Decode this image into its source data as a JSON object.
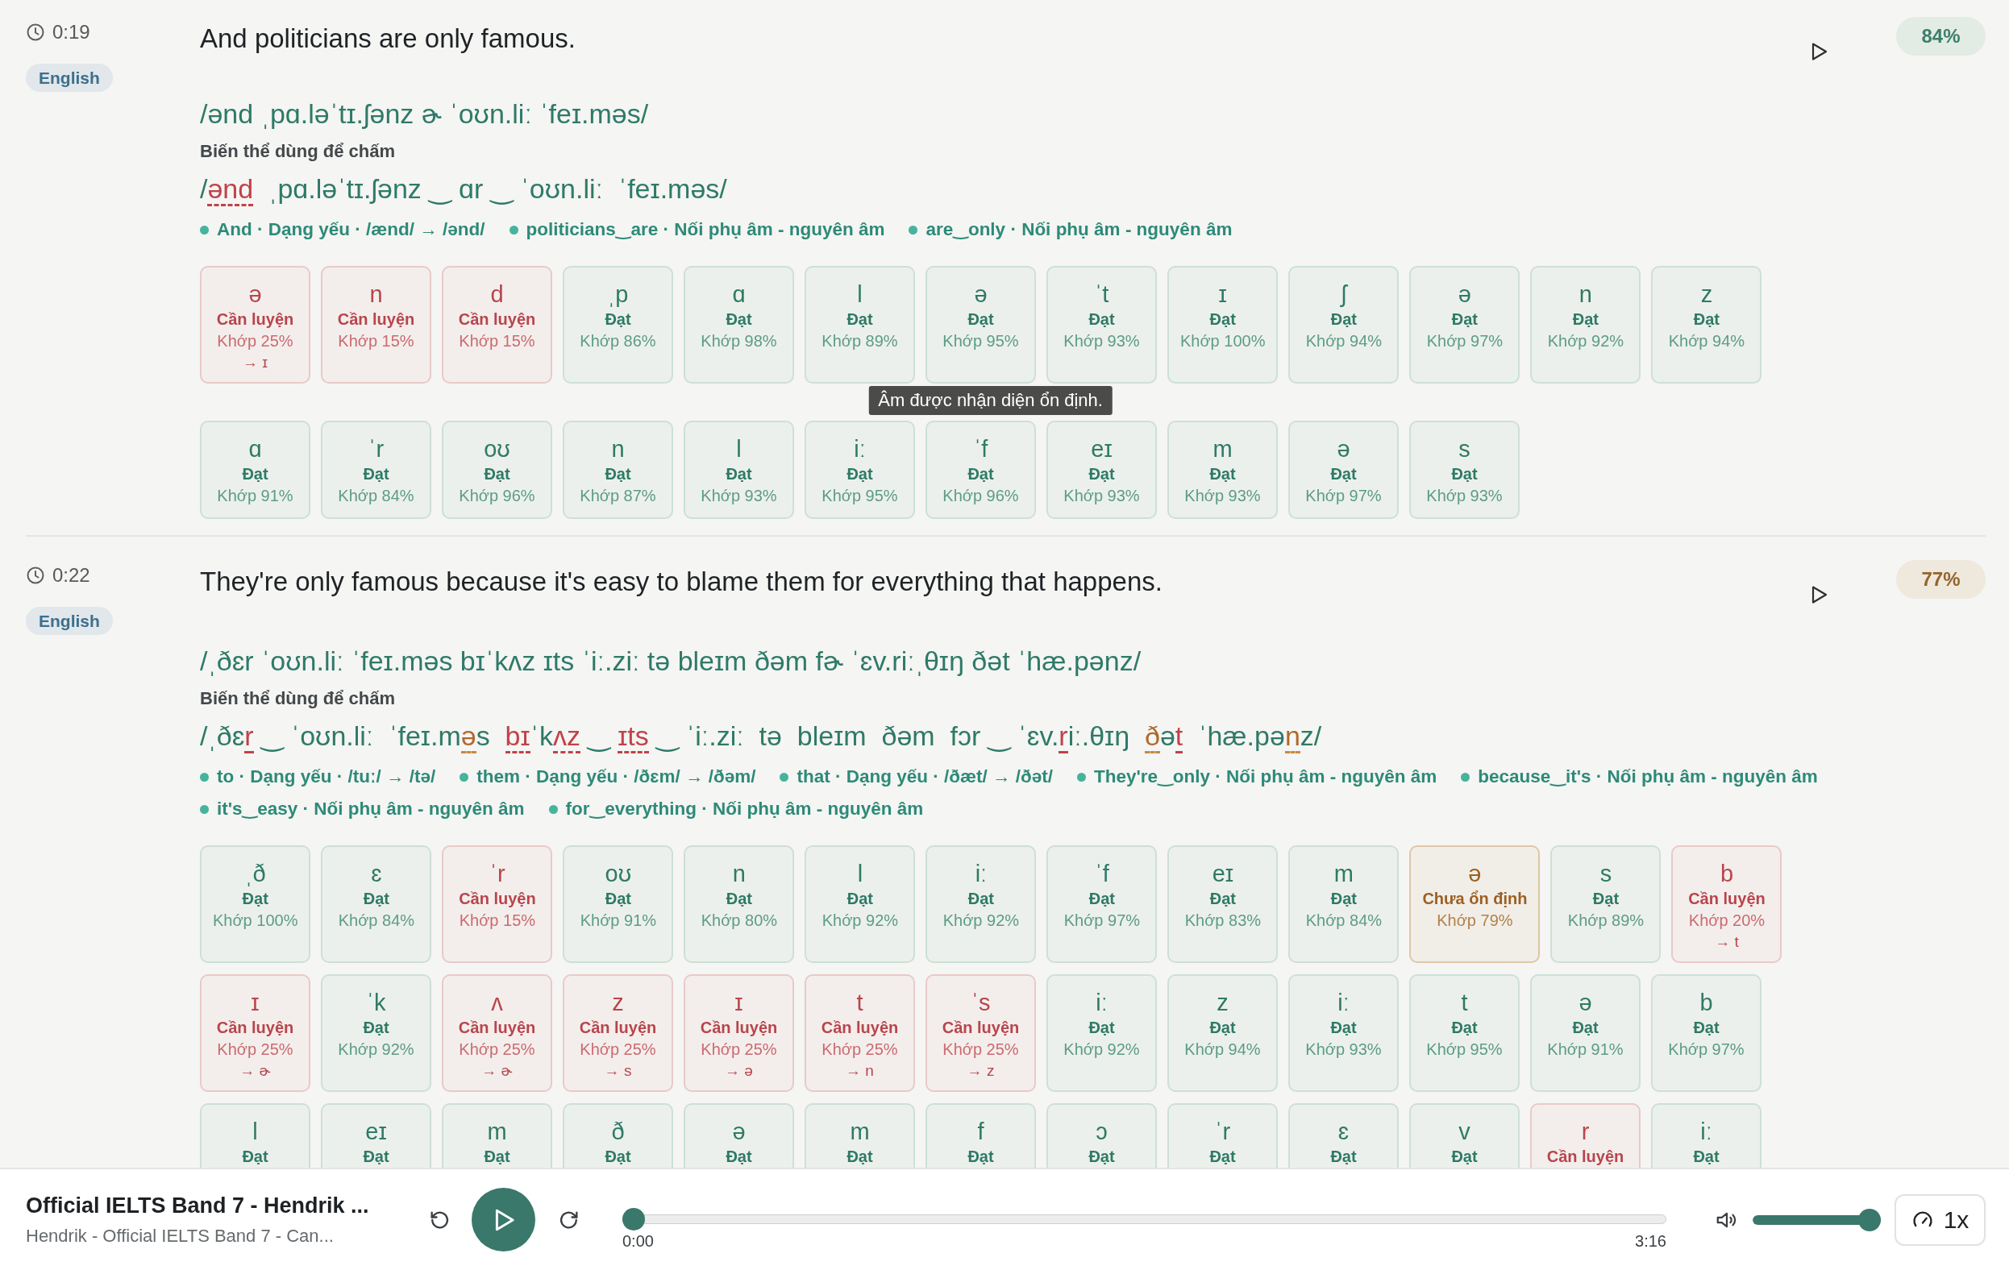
{
  "segments": [
    {
      "time": "0:19",
      "language": "English",
      "sentence": "And politicians are only famous.",
      "score": {
        "text": "84%",
        "kind": "good"
      },
      "ipa": "/ənd ˌpɑ.ləˈtɪ.ʃənz ɚ ˈoʊn.liː ˈfeɪ.məs/",
      "variant_label": "Biến thể dùng để chấm",
      "variant": [
        {
          "text": "/",
          "kind": "plain"
        },
        {
          "text": "ənd",
          "kind": "error"
        },
        {
          "text": "  ˌpɑ.ləˈtɪ.ʃənz ‿ ɑr ‿ ˈoʊn.liː  ˈfeɪ.məs/",
          "kind": "plain"
        }
      ],
      "notes": [
        "And · Dạng yếu · /ænd/ → /ənd/",
        "politicians‿are · Nối phụ âm - nguyên âm",
        "are‿only · Nối phụ âm - nguyên âm"
      ],
      "phonemes": [
        {
          "symbol": "ə",
          "status": "Cần luyện",
          "kind": "practice",
          "match": "Khớp 25%",
          "heard": "→ ɪ"
        },
        {
          "symbol": "n",
          "status": "Cần luyện",
          "kind": "practice",
          "match": "Khớp 15%"
        },
        {
          "symbol": "d",
          "status": "Cần luyện",
          "kind": "practice",
          "match": "Khớp 15%"
        },
        {
          "symbol": "ˌp",
          "status": "Đạt",
          "kind": "pass",
          "match": "Khớp 86%"
        },
        {
          "symbol": "ɑ",
          "status": "Đạt",
          "kind": "pass",
          "match": "Khớp 98%"
        },
        {
          "symbol": "l",
          "status": "Đạt",
          "kind": "pass",
          "match": "Khớp 89%"
        },
        {
          "symbol": "ə",
          "status": "Đạt",
          "kind": "pass",
          "match": "Khớp 95%",
          "tooltip": "Âm được nhận diện ổn định."
        },
        {
          "symbol": "ˈt",
          "status": "Đạt",
          "kind": "pass",
          "match": "Khớp 93%"
        },
        {
          "symbol": "ɪ",
          "status": "Đạt",
          "kind": "pass",
          "match": "Khớp 100%"
        },
        {
          "symbol": "ʃ",
          "status": "Đạt",
          "kind": "pass",
          "match": "Khớp 94%"
        },
        {
          "symbol": "ə",
          "status": "Đạt",
          "kind": "pass",
          "match": "Khớp 97%"
        },
        {
          "symbol": "n",
          "status": "Đạt",
          "kind": "pass",
          "match": "Khớp 92%"
        },
        {
          "symbol": "z",
          "status": "Đạt",
          "kind": "pass",
          "match": "Khớp 94%"
        },
        {
          "symbol": "ɑ",
          "status": "Đạt",
          "kind": "pass",
          "match": "Khớp 91%"
        },
        {
          "symbol": "ˈr",
          "status": "Đạt",
          "kind": "pass",
          "match": "Khớp 84%"
        },
        {
          "symbol": "oʊ",
          "status": "Đạt",
          "kind": "pass",
          "match": "Khớp 96%"
        },
        {
          "symbol": "n",
          "status": "Đạt",
          "kind": "pass",
          "match": "Khớp 87%"
        },
        {
          "symbol": "l",
          "status": "Đạt",
          "kind": "pass",
          "match": "Khớp 93%"
        },
        {
          "symbol": "iː",
          "status": "Đạt",
          "kind": "pass",
          "match": "Khớp 95%"
        },
        {
          "symbol": "ˈf",
          "status": "Đạt",
          "kind": "pass",
          "match": "Khớp 96%"
        },
        {
          "symbol": "eɪ",
          "status": "Đạt",
          "kind": "pass",
          "match": "Khớp 93%"
        },
        {
          "symbol": "m",
          "status": "Đạt",
          "kind": "pass",
          "match": "Khớp 93%"
        },
        {
          "symbol": "ə",
          "status": "Đạt",
          "kind": "pass",
          "match": "Khớp 97%"
        },
        {
          "symbol": "s",
          "status": "Đạt",
          "kind": "pass",
          "match": "Khớp 93%"
        }
      ]
    },
    {
      "time": "0:22",
      "language": "English",
      "sentence": "They're only famous because it's easy to blame them for everything that happens.",
      "score": {
        "text": "77%",
        "kind": "fair"
      },
      "ipa": "/ˌðɛr ˈoʊn.liː ˈfeɪ.məs bɪˈkʌz ɪts ˈiː.ziː tə bleɪm ðəm fɚ ˈɛv.riːˌθɪŋ ðət ˈhæ.pənz/",
      "variant_label": "Biến thể dùng để chấm",
      "variant": [
        {
          "text": "/ˌðɛ",
          "kind": "plain"
        },
        {
          "text": "r",
          "kind": "error"
        },
        {
          "text": " ‿ ˈoʊn.liː  ˈfeɪ.m",
          "kind": "plain"
        },
        {
          "text": "ə",
          "kind": "warn"
        },
        {
          "text": "s  ",
          "kind": "plain"
        },
        {
          "text": "bɪ",
          "kind": "error"
        },
        {
          "text": "ˈk",
          "kind": "plain"
        },
        {
          "text": "ʌz",
          "kind": "error"
        },
        {
          "text": " ‿ ",
          "kind": "plain"
        },
        {
          "text": "ɪts",
          "kind": "error"
        },
        {
          "text": " ‿ ˈiː.ziː  tə  bleɪm  ðəm  fɔr ‿ ˈɛv.",
          "kind": "plain"
        },
        {
          "text": "r",
          "kind": "error"
        },
        {
          "text": "iː.θɪŋ  ",
          "kind": "plain"
        },
        {
          "text": "ð",
          "kind": "warn"
        },
        {
          "text": "ə",
          "kind": "plain"
        },
        {
          "text": "t",
          "kind": "error"
        },
        {
          "text": "  ˈhæ.pə",
          "kind": "plain"
        },
        {
          "text": "n",
          "kind": "warn"
        },
        {
          "text": "z/",
          "kind": "plain"
        }
      ],
      "notes": [
        "to · Dạng yếu · /tuː/ → /tə/",
        "them · Dạng yếu · /ðɛm/ → /ðəm/",
        "that · Dạng yếu · /ðæt/ → /ðət/",
        "They're‿only · Nối phụ âm - nguyên âm",
        "because‿it's · Nối phụ âm - nguyên âm",
        "it's‿easy · Nối phụ âm - nguyên âm",
        "for‿everything · Nối phụ âm - nguyên âm"
      ],
      "phonemes": [
        {
          "symbol": "ˌð",
          "status": "Đạt",
          "kind": "pass",
          "match": "Khớp 100%"
        },
        {
          "symbol": "ɛ",
          "status": "Đạt",
          "kind": "pass",
          "match": "Khớp 84%"
        },
        {
          "symbol": "ˈr",
          "status": "Cần luyện",
          "kind": "practice",
          "match": "Khớp 15%"
        },
        {
          "symbol": "oʊ",
          "status": "Đạt",
          "kind": "pass",
          "match": "Khớp 91%"
        },
        {
          "symbol": "n",
          "status": "Đạt",
          "kind": "pass",
          "match": "Khớp 80%"
        },
        {
          "symbol": "l",
          "status": "Đạt",
          "kind": "pass",
          "match": "Khớp 92%"
        },
        {
          "symbol": "iː",
          "status": "Đạt",
          "kind": "pass",
          "match": "Khớp 92%"
        },
        {
          "symbol": "ˈf",
          "status": "Đạt",
          "kind": "pass",
          "match": "Khớp 97%"
        },
        {
          "symbol": "eɪ",
          "status": "Đạt",
          "kind": "pass",
          "match": "Khớp 83%"
        },
        {
          "symbol": "m",
          "status": "Đạt",
          "kind": "pass",
          "match": "Khớp 84%"
        },
        {
          "symbol": "ə",
          "status": "Chưa ổn định",
          "kind": "unstable",
          "match": "Khớp 79%"
        },
        {
          "symbol": "s",
          "status": "Đạt",
          "kind": "pass",
          "match": "Khớp 89%"
        },
        {
          "symbol": "b",
          "status": "Cần luyện",
          "kind": "practice",
          "match": "Khớp 20%",
          "heard": "→ t"
        },
        {
          "symbol": "ɪ",
          "status": "Cần luyện",
          "kind": "practice",
          "match": "Khớp 25%",
          "heard": "→ ɚ"
        },
        {
          "symbol": "ˈk",
          "status": "Đạt",
          "kind": "pass",
          "match": "Khớp 92%"
        },
        {
          "symbol": "ʌ",
          "status": "Cần luyện",
          "kind": "practice",
          "match": "Khớp 25%",
          "heard": "→ ɚ"
        },
        {
          "symbol": "z",
          "status": "Cần luyện",
          "kind": "practice",
          "match": "Khớp 25%",
          "heard": "→ s"
        },
        {
          "symbol": "ɪ",
          "status": "Cần luyện",
          "kind": "practice",
          "match": "Khớp 25%",
          "heard": "→ ə"
        },
        {
          "symbol": "t",
          "status": "Cần luyện",
          "kind": "practice",
          "match": "Khớp 25%",
          "heard": "→ n"
        },
        {
          "symbol": "ˈs",
          "status": "Cần luyện",
          "kind": "practice",
          "match": "Khớp 25%",
          "heard": "→ z"
        },
        {
          "symbol": "iː",
          "status": "Đạt",
          "kind": "pass",
          "match": "Khớp 92%"
        },
        {
          "symbol": "z",
          "status": "Đạt",
          "kind": "pass",
          "match": "Khớp 94%"
        },
        {
          "symbol": "iː",
          "status": "Đạt",
          "kind": "pass",
          "match": "Khớp 93%"
        },
        {
          "symbol": "t",
          "status": "Đạt",
          "kind": "pass",
          "match": "Khớp 95%"
        },
        {
          "symbol": "ə",
          "status": "Đạt",
          "kind": "pass",
          "match": "Khớp 91%"
        },
        {
          "symbol": "b",
          "status": "Đạt",
          "kind": "pass",
          "match": "Khớp 97%"
        },
        {
          "symbol": "l",
          "status": "Đạt",
          "kind": "pass"
        },
        {
          "symbol": "eɪ",
          "status": "Đạt",
          "kind": "pass"
        },
        {
          "symbol": "m",
          "status": "Đạt",
          "kind": "pass"
        },
        {
          "symbol": "ð",
          "status": "Đạt",
          "kind": "pass"
        },
        {
          "symbol": "ə",
          "status": "Đạt",
          "kind": "pass"
        },
        {
          "symbol": "m",
          "status": "Đạt",
          "kind": "pass"
        },
        {
          "symbol": "f",
          "status": "Đạt",
          "kind": "pass"
        },
        {
          "symbol": "ɔ",
          "status": "Đạt",
          "kind": "pass"
        },
        {
          "symbol": "ˈr",
          "status": "Đạt",
          "kind": "pass"
        },
        {
          "symbol": "ɛ",
          "status": "Đạt",
          "kind": "pass"
        },
        {
          "symbol": "v",
          "status": "Đạt",
          "kind": "pass"
        },
        {
          "symbol": "r",
          "status": "Cần luyện",
          "kind": "practice"
        },
        {
          "symbol": "iː",
          "status": "Đạt",
          "kind": "pass"
        }
      ]
    }
  ],
  "player": {
    "title": "Official IELTS Band 7 - Hendrik ...",
    "subtitle": "Hendrik - Official IELTS Band 7 - Can...",
    "progress": {
      "level": 0
    },
    "elapsed": "0:00",
    "duration": "3:16",
    "volume": {
      "level": 1
    },
    "speed": "1x"
  }
}
